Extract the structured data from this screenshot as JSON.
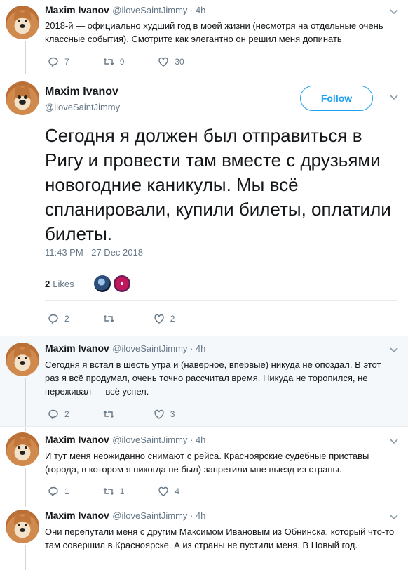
{
  "tweets": {
    "t1": {
      "name": "Maxim Ivanov",
      "handle": "@iloveSaintJimmy · 4h",
      "text": "2018-й — официально худший год в моей жизни (несмотря на отдельные очень классные события). Смотрите как элегантно он решил меня допинать",
      "replies": "7",
      "retweets": "9",
      "likes": "30"
    },
    "main": {
      "name": "Maxim Ivanov",
      "handle": "@iloveSaintJimmy",
      "follow_label": "Follow",
      "text": "Сегодня я должен был отправиться в Ригу и провести там вместе с друзьями новогодние каникулы. Мы всё спланировали, купили билеты, оплатили билеты.",
      "timestamp": "11:43 PM - 27 Dec 2018",
      "likes_count": "2",
      "likes_label": "Likes",
      "replies": "2",
      "retweets": "",
      "likes": "2"
    },
    "t3": {
      "name": "Maxim Ivanov",
      "handle": "@iloveSaintJimmy · 4h",
      "text": "Сегодня я встал в шесть утра и (наверное, впервые) никуда не опоздал. В этот раз я всё продумал, очень точно рассчитал время. Никуда не торопился, не переживал — всё успел.",
      "replies": "2",
      "retweets": "",
      "likes": "3"
    },
    "t4": {
      "name": "Maxim Ivanov",
      "handle": "@iloveSaintJimmy · 4h",
      "text": "И тут меня неожиданно снимают с рейса. Красноярские судебные приставы (города, в котором я никогда не был) запретили мне выезд из страны.",
      "replies": "1",
      "retweets": "1",
      "likes": "4"
    },
    "t5": {
      "name": "Maxim Ivanov",
      "handle": "@iloveSaintJimmy · 4h",
      "text": "Они перепутали меня с другим Максимом Ивановым из Обнинска, который что-то там совершил в Красноярске. А из страны не пустили меня. В Новый год."
    }
  },
  "colors": {
    "accent": "#1da1f2",
    "muted": "#657786",
    "thread_line": "#ccd6dd",
    "highlight_bg": "#f5f8fa"
  },
  "icons": [
    "reply-icon",
    "retweet-icon",
    "like-icon",
    "caret-down-icon"
  ]
}
